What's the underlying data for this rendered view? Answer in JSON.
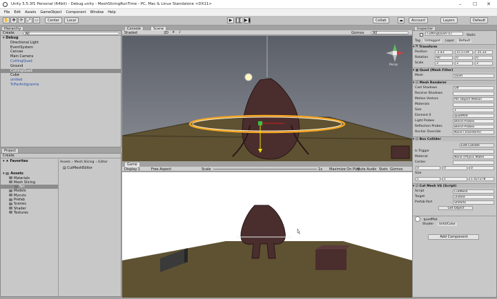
{
  "window": {
    "title": "Unity 5.5.3f1 Personal (64bit) - Debug.unity - MeshSlicingRunTime - PC, Mac & Linux Standalone <DX11>"
  },
  "menu": [
    "File",
    "Edit",
    "Assets",
    "GameObject",
    "Component",
    "Window",
    "Help"
  ],
  "toolbar": {
    "center_label": "Center",
    "local_label": "Local",
    "collab_label": "Collab",
    "account_label": "Account",
    "layers_label": "Layers",
    "layout_label": "Default"
  },
  "hierarchy": {
    "tab": "Hierarchy",
    "create": "Create",
    "search_placeholder": "All",
    "scene": "Debug",
    "items": [
      {
        "label": "Directional Light",
        "sel": false,
        "blue": false
      },
      {
        "label": "EventSystem",
        "sel": false,
        "blue": false
      },
      {
        "label": "Canvas",
        "sel": false,
        "blue": false
      },
      {
        "label": "Main Camera",
        "sel": false,
        "blue": false
      },
      {
        "label": "CuttingQuad",
        "sel": false,
        "blue": true
      },
      {
        "label": "Ground",
        "sel": false,
        "blue": false
      },
      {
        "label": "CuttingQuad",
        "sel": true,
        "blue": false
      },
      {
        "label": "Cube",
        "sel": false,
        "blue": false
      },
      {
        "label": "unitled",
        "sel": false,
        "blue": true
      },
      {
        "label": "TriFarAntigramta",
        "sel": false,
        "blue": true
      }
    ]
  },
  "scene": {
    "tabs": [
      "Console",
      "Scene"
    ],
    "shading": "Shaded",
    "mode2d": "2D",
    "gizmos": "Gizmos",
    "search": "All",
    "persp": "Persp"
  },
  "game": {
    "tab": "Game",
    "display": "Display 1",
    "aspect": "Free Aspect",
    "scale_label": "Scale",
    "scale_value": "1x",
    "buttons": [
      "Maximize On Play",
      "Mute Audio",
      "Stats",
      "Gizmos"
    ]
  },
  "project": {
    "tab": "Project",
    "create": "Create",
    "favorites": "Favorites",
    "assets": "Assets",
    "tree": [
      "Materials",
      "Mesh Slicing",
      "Src",
      "Models",
      "Mycuts",
      "Prefab",
      "Scenes",
      "Shader",
      "Textures"
    ],
    "breadcrumb": [
      "Assets",
      "Mesh Slicing",
      "Editor"
    ],
    "files": [
      "CutMeshEditor"
    ]
  },
  "inspector": {
    "tab": "Inspector",
    "object_name": "CuttingQuad (1)",
    "static": "Static",
    "tag_label": "Tag",
    "tag": "Untagged",
    "layer_label": "Layer",
    "layer": "Default",
    "transform": {
      "title": "Transform",
      "position": {
        "label": "Position",
        "x": "-2.43",
        "y": "15.5729",
        "z": "-35.33"
      },
      "rotation": {
        "label": "Rotation",
        "x": "90",
        "y": "0",
        "z": "0"
      },
      "scale": {
        "label": "Scale",
        "x": "3",
        "y": "3",
        "z": "3"
      }
    },
    "mesh_filter": {
      "title": "Quad (Mesh Filter)",
      "mesh_label": "Mesh",
      "mesh": "Quad"
    },
    "mesh_renderer": {
      "title": "Mesh Renderer",
      "rows": [
        [
          "Cast Shadows",
          "Off"
        ],
        [
          "Receive Shadows",
          ""
        ],
        [
          "Motion Vectors",
          "Per Object Motion"
        ],
        [
          "Materials",
          ""
        ],
        [
          "Size",
          "1"
        ],
        [
          "Element 0",
          "quadMat"
        ],
        [
          "Light Probes",
          "Blend Probes"
        ],
        [
          "Reflection Probes",
          "Blend Probes"
        ],
        [
          "Anchor Override",
          "None (Transform)"
        ]
      ]
    },
    "box_collider": {
      "title": "Box Collider",
      "edit": "Edit Collider",
      "rows": [
        [
          "Is Trigger",
          ""
        ],
        [
          "Material",
          "None (Physic Mater"
        ],
        [
          "Center",
          ""
        ]
      ],
      "center": {
        "x": "0",
        "y": "0",
        "z": "0"
      },
      "size_label": "Size",
      "size": {
        "x": "1",
        "y": "1",
        "z": "1.427278"
      }
    },
    "cut_mesh": {
      "title": "Cut Mesh V4 (Script)",
      "rows": [
        [
          "Script",
          "CutMesh"
        ],
        [
          "Target",
          "unitled"
        ],
        [
          "Prefab Part",
          "ShParts"
        ]
      ],
      "get_object": "Get Object"
    },
    "material": {
      "name": "quadMat",
      "shader_label": "Shader",
      "shader": "Unlit/Color"
    },
    "add_component": "Add Component"
  }
}
